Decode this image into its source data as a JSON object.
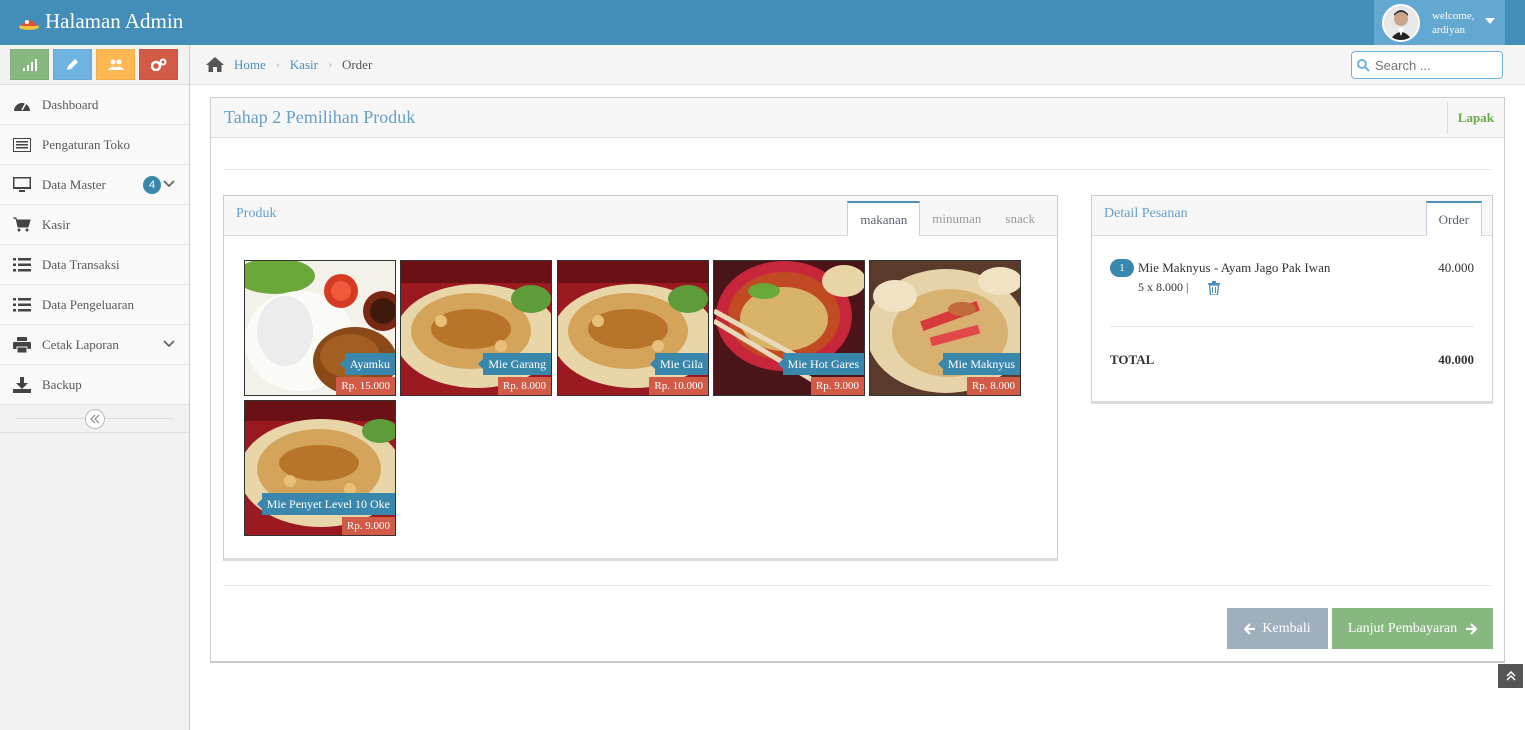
{
  "navbar": {
    "brand": "Halaman Admin",
    "welcome": "welcome,",
    "username": "ardiyan"
  },
  "colors": {
    "primary": "#438eb9",
    "success": "#87b87f",
    "danger": "#d15b47",
    "info": "#3a87ad",
    "warning": "#f89406"
  },
  "shortcuts": [
    {
      "icon": "signal-icon",
      "color": "#87b87f"
    },
    {
      "icon": "pencil-icon",
      "color": "#6fb3e0"
    },
    {
      "icon": "users-icon",
      "color": "#ffb752"
    },
    {
      "icon": "cogs-icon",
      "color": "#d15b47"
    }
  ],
  "sidebar": {
    "items": [
      {
        "label": "Dashboard",
        "icon": "dashboard-icon"
      },
      {
        "label": "Pengaturan Toko",
        "icon": "list-alt-icon"
      },
      {
        "label": "Data Master",
        "icon": "desktop-icon",
        "badge": "4"
      },
      {
        "label": "Kasir",
        "icon": "cart-icon"
      },
      {
        "label": "Data Transaksi",
        "icon": "list-icon"
      },
      {
        "label": "Data Pengeluaran",
        "icon": "list-icon"
      },
      {
        "label": "Cetak Laporan",
        "icon": "print-icon"
      },
      {
        "label": "Backup",
        "icon": "download-icon"
      }
    ]
  },
  "breadcrumb": {
    "home": "Home",
    "kasir": "Kasir",
    "current": "Order"
  },
  "search": {
    "placeholder": "Search ..."
  },
  "widget": {
    "title": "Tahap 2 Pemilihan Produk",
    "toolbar": "Lapak"
  },
  "produk": {
    "title": "Produk",
    "tabs": [
      "makanan",
      "minuman",
      "snack"
    ],
    "items": [
      {
        "name": "Ayamku",
        "price": "Rp. 15.000"
      },
      {
        "name": "Mie Garang",
        "price": "Rp. 8.000"
      },
      {
        "name": "Mie Gila",
        "price": "Rp. 10.000"
      },
      {
        "name": "Mie Hot Gares",
        "price": "Rp. 9.000"
      },
      {
        "name": "Mie Maknyus",
        "price": "Rp. 8.000"
      },
      {
        "name": "Mie Penyet Level 10 Oke",
        "price": "Rp. 9.000"
      }
    ]
  },
  "detail": {
    "title": "Detail Pesanan",
    "tab": "Order",
    "items": [
      {
        "qty": "1",
        "name": "Mie Maknyus - Ayam Jago Pak Iwan",
        "sub": "5 x 8.000 |",
        "price": "40.000"
      }
    ],
    "total_label": "TOTAL",
    "total_value": "40.000"
  },
  "buttons": {
    "back": "Kembali",
    "next": "Lanjut Pembayaran"
  }
}
